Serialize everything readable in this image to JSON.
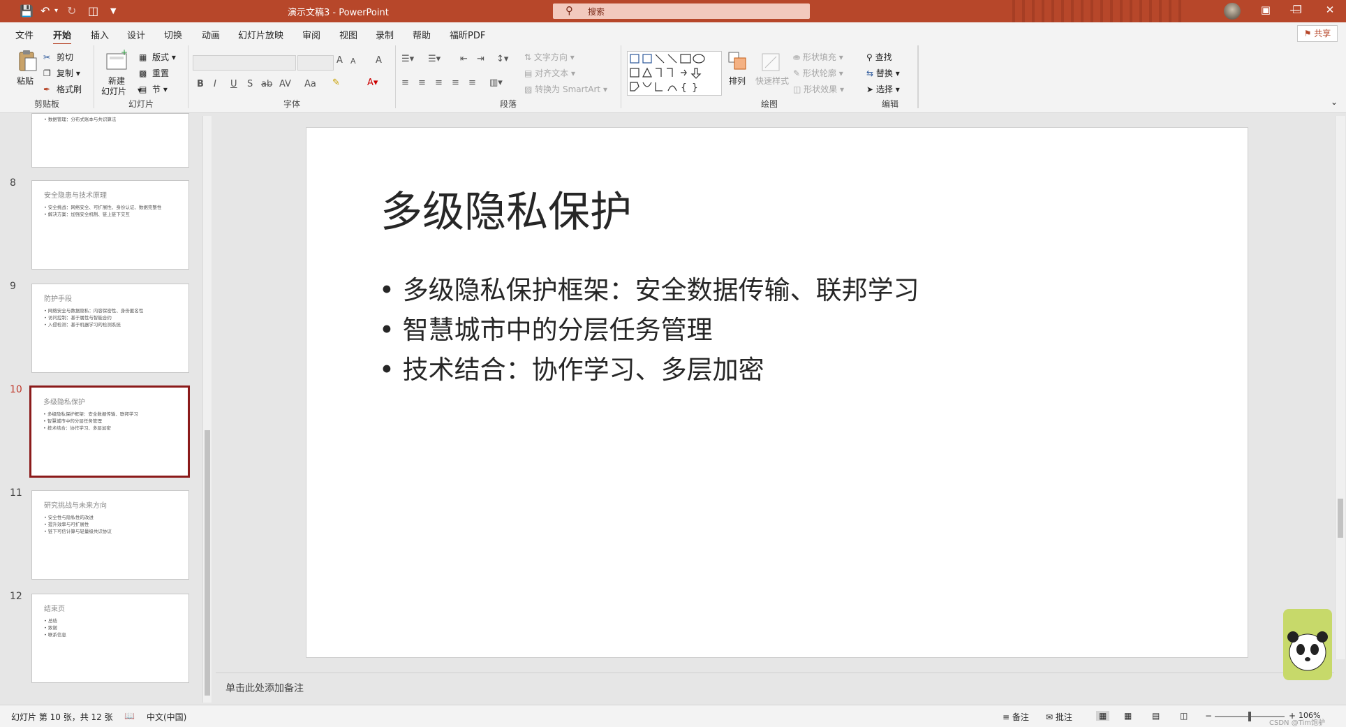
{
  "window": {
    "doc_title": "演示文稿3",
    "sep": " - ",
    "app_name": "PowerPoint",
    "search_placeholder": "搜索"
  },
  "menu": {
    "tabs": [
      "文件",
      "开始",
      "插入",
      "设计",
      "切换",
      "动画",
      "幻灯片放映",
      "审阅",
      "视图",
      "录制",
      "帮助",
      "福昕PDF"
    ],
    "active": "开始",
    "share": "共享"
  },
  "ribbon": {
    "clipboard": {
      "paste": "粘贴",
      "cut": "剪切",
      "copy": "复制",
      "format_painter": "格式刷",
      "label": "剪贴板"
    },
    "slides": {
      "new_slide": "新建",
      "new_slide2": "幻灯片",
      "layout": "版式",
      "reset": "重置",
      "section": "节",
      "label": "幻灯片"
    },
    "font": {
      "label": "字体",
      "bold": "B",
      "italic": "I",
      "underline": "U",
      "shadow": "S",
      "strike": "ab",
      "spacing": "AV",
      "case": "Aa",
      "grow": "A",
      "shrink": "A",
      "clear": "A"
    },
    "paragraph": {
      "text_direction": "文字方向",
      "align_text": "对齐文本",
      "smartart": "转换为 SmartArt",
      "label": "段落"
    },
    "drawing": {
      "arrange": "排列",
      "quick_styles": "快速样式",
      "fill": "形状填充",
      "outline": "形状轮廓",
      "effects": "形状效果",
      "label": "绘图"
    },
    "editing": {
      "find": "查找",
      "replace": "替换",
      "select": "选择",
      "label": "编辑"
    }
  },
  "thumbnails": [
    {
      "num": "",
      "title": "",
      "lines": [
        "• 数据管理：分布式账本与共识算法"
      ]
    },
    {
      "num": "8",
      "title": "安全隐患与技术原理",
      "lines": [
        "• 安全挑战：网络安全、可扩展性、身份认证、数据完整性",
        "• 解决方案：加强安全机制、链上链下交互"
      ]
    },
    {
      "num": "9",
      "title": "防护手段",
      "lines": [
        "• 网络安全与数据隐私：内容保密性、身份匿名性",
        "• 访问控制：基于属性与智能合约",
        "• 入侵检测：基于机器学习的检测系统"
      ]
    },
    {
      "num": "10",
      "title": "多级隐私保护",
      "lines": [
        "• 多级隐私保护框架：安全数据传输、联邦学习",
        "• 智慧城市中的分层任务管理",
        "• 技术结合：协作学习、多层加密"
      ]
    },
    {
      "num": "11",
      "title": "研究挑战与未来方向",
      "lines": [
        "• 安全性与隐私性的改进",
        "• 提升效率与可扩展性",
        "• 链下可信计算与轻量级共识协议"
      ]
    },
    {
      "num": "12",
      "title": "结束页",
      "lines": [
        "• 总结",
        "• 致谢",
        "• 联系信息"
      ]
    }
  ],
  "slide": {
    "title": "多级隐私保护",
    "bullets": [
      "多级隐私保护框架：安全数据传输、联邦学习",
      "智慧城市中的分层任务管理",
      "技术结合：协作学习、多层加密"
    ]
  },
  "notes_placeholder": "单击此处添加备注",
  "status": {
    "slide_info": "幻灯片 第 10 张，共 12 张",
    "language": "中文(中国)",
    "notes": "备注",
    "comments": "批注",
    "zoom": "106%",
    "watermark": "CSDN @Tim饱驴"
  },
  "colors": {
    "accent": "#b7472a",
    "selected_border": "#8b1a1a"
  }
}
